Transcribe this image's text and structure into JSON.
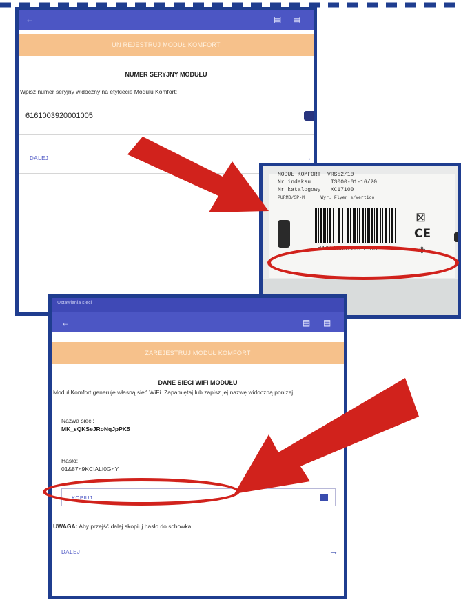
{
  "top_screen": {
    "banner": "UN REJESTRUJ MODUŁ KOMFORT",
    "heading": "NUMER SERYJNY MODUŁU",
    "instruction": "Wpisz numer seryjny widoczny na etykiecie Modułu Komfort:",
    "serial_value": "6161003920001005",
    "next_label": "DALEJ",
    "next_arrow": "→"
  },
  "label_photo": {
    "line1": "MODUŁ KOMFORT  VRS52/10",
    "line2": "Nr indeksu      TS000-01-16/20",
    "line3": "Nr katalogowy   XC17100",
    "line4": "PURMO/SP-M      Wyr. Flyer's/Vertico",
    "serial_print": "d1610039200z1005",
    "ce_mark": "CE"
  },
  "bottom_screen": {
    "status_text": "Ustawienia sieci",
    "banner": "ZAREJESTRUJ MODUŁ KOMFORT",
    "heading": "DANE SIECI WIFI MODUŁU",
    "description": "Moduł Komfort generuje własną sieć WiFi. Zapamiętaj lub zapisz jej nazwę widoczną poniżej.",
    "network_name_label": "Nazwa sieci:",
    "network_name_value": "MK_sQKSeJRoNqJpPK5",
    "password_label": "Hasło:",
    "password_value": "01&87<9KCIALI0G<Y",
    "copy_button": "KOPIUJ",
    "warning_bold": "UWAGA:",
    "warning_text": " Aby przejść dalej skopiuj hasło do schowka.",
    "next_label": "DALEJ",
    "next_arrow": "→"
  },
  "colors": {
    "frame": "#1f3d8f",
    "app_bar": "#4c56c4",
    "banner": "#f6c18b",
    "highlight_red": "#d1221c"
  }
}
